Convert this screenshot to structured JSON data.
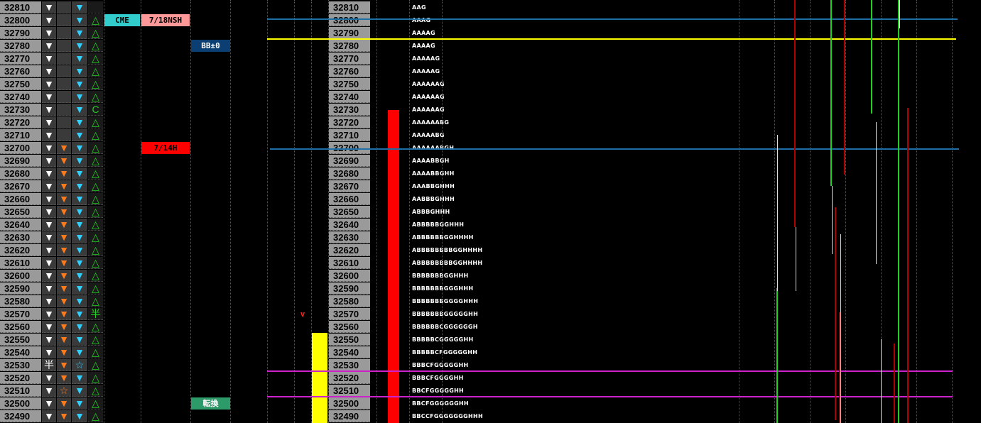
{
  "prices": [
    "32810",
    "32800",
    "32790",
    "32780",
    "32770",
    "32760",
    "32750",
    "32740",
    "32730",
    "32720",
    "32710",
    "32700",
    "32690",
    "32680",
    "32670",
    "32660",
    "32650",
    "32640",
    "32630",
    "32620",
    "32610",
    "32600",
    "32590",
    "32580",
    "32570",
    "32560",
    "32550",
    "32540",
    "32530",
    "32520",
    "32510",
    "32500",
    "32490"
  ],
  "col1": [
    "▼",
    "▼",
    "▼",
    "▼",
    "▼",
    "▼",
    "▼",
    "▼",
    "▼",
    "▼",
    "▼",
    "▼",
    "▼",
    "▼",
    "▼",
    "▼",
    "▼",
    "▼",
    "▼",
    "▼",
    "▼",
    "▼",
    "▼",
    "▼",
    "▼",
    "▼",
    "▼",
    "▼",
    "半",
    "▼",
    "▼",
    "▼",
    "▼"
  ],
  "col2": [
    "",
    "",
    "",
    "",
    "",
    "",
    "",
    "",
    "",
    "",
    "",
    "▼",
    "▼",
    "▼",
    "▼",
    "▼",
    "▼",
    "▼",
    "▼",
    "▼",
    "▼",
    "▼",
    "▼",
    "▼",
    "▼",
    "▼",
    "▼",
    "▼",
    "▼",
    "▼",
    "☆",
    "▼",
    "▼"
  ],
  "col3": [
    "▼",
    "▼",
    "▼",
    "▼",
    "▼",
    "▼",
    "▼",
    "▼",
    "▼",
    "▼",
    "▼",
    "▼",
    "▼",
    "▼",
    "▼",
    "▼",
    "▼",
    "▼",
    "▼",
    "▼",
    "▼",
    "▼",
    "▼",
    "▼",
    "▼",
    "▼",
    "▼",
    "▼",
    "☆",
    "▼",
    "▼",
    "▼",
    "▼"
  ],
  "col4": [
    "",
    "△",
    "△",
    "△",
    "△",
    "△",
    "△",
    "△",
    "C",
    "△",
    "△",
    "△",
    "△",
    "△",
    "△",
    "△",
    "△",
    "△",
    "△",
    "△",
    "△",
    "△",
    "△",
    "△",
    "半",
    "△",
    "△",
    "△",
    "△",
    "△",
    "△",
    "△",
    "△"
  ],
  "tags": {
    "cme": "CME",
    "nsh": "7/18NSH",
    "bb": "BB±0",
    "h14": "7/14H",
    "tenkan": "転換",
    "v": "v"
  },
  "profile": [
    "AAG",
    "AAAG",
    "AAAAG",
    "AAAAG",
    "AAAAAG",
    "AAAAAG",
    "AAAAAAG",
    "AAAAAAG",
    "AAAAAAG",
    "AAAAAABG",
    "AAAAABG",
    "AAAAAABGH",
    "AAAABBGH",
    "AAAABBGHH",
    "AAABBGHHH",
    "AABBBGHHH",
    "ABBBGHHH",
    "ABBBBBGGHHH",
    "ABBBBBBGGHHHH",
    "ABBBBBBBBGGHHHH",
    "ABBBBBBBBGGHHHH",
    "BBBBBBBGGHHH",
    "BBBBBBBGGGHHH",
    "BBBBBBBGGGGHHH",
    "BBBBBBBGGGGGHH",
    "BBBBBBCGGGGGGH",
    "BBBBBCGGGGGHH",
    "BBBBBCFGGGGGHH",
    "BBBCFGGGGGHH",
    "BBBCFGGGGHH",
    "BBCFGGGGGHH",
    "BBCFGGGGGGHH",
    "BBCCFGGGGGGGHHH"
  ],
  "colors": {
    "grey": "#9a9a9a",
    "orange": "#ff7a1a",
    "cyan": "#2fd0ff",
    "green": "#22d022",
    "red": "#ff0000",
    "yellow": "#ffff00",
    "magenta": "#cc22cc",
    "blue": "#1e6fa6"
  }
}
